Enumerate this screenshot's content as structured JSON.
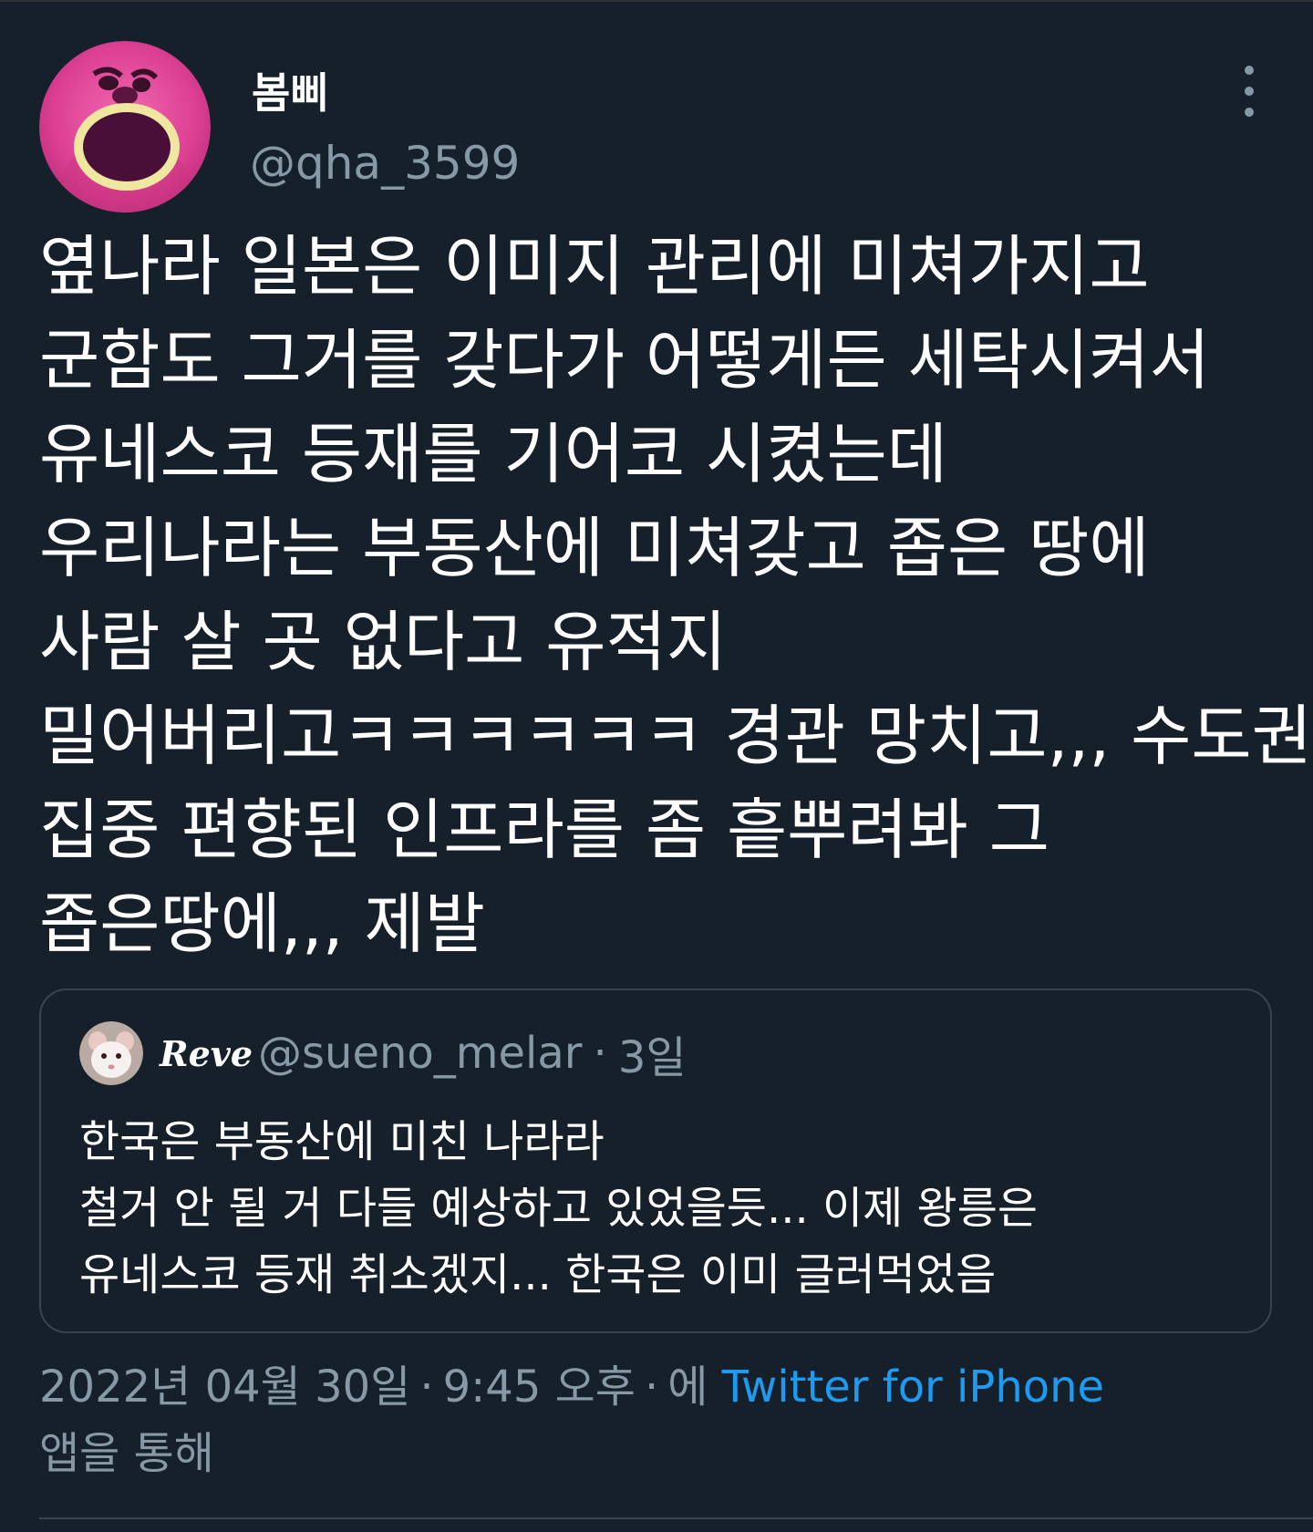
{
  "tweet": {
    "author": {
      "display_name": "봄삐",
      "handle": "@qha_3599",
      "avatar_icon": "pink-bear-face-avatar"
    },
    "more_icon": "more-vertical-icon",
    "text_lines": [
      "옆나라 일본은 이미지 관리에 미쳐가지고",
      "군함도 그거를 갖다가 어떻게든 세탁시켜서",
      "유네스코 등재를 기어코 시켰는데",
      "우리나라는 부동산에 미쳐갖고 좁은 땅에",
      "사람 살 곳 없다고 유적지",
      "밀어버리고ㅋㅋㅋㅋㅋㅋ 경관 망치고,,, 수도권",
      "집중 편향된 인프라를 좀 흩뿌려봐 그",
      "좁은땅에,,, 제발"
    ],
    "quote": {
      "name": "Reve",
      "handle": "@sueno_melar",
      "separator": "·",
      "time": "3일",
      "avatar_icon": "white-mouse-avatar",
      "text_lines": [
        "한국은 부동산에 미친 나라라",
        "철거 안 될 거 다들 예상하고 있었을듯... 이제 왕릉은",
        "유네스코 등재 취소겠지... 한국은 이미 글러먹었음"
      ]
    },
    "meta": {
      "date": "2022년 04월 30일",
      "separator": "·",
      "time": "9:45 오후",
      "via_prefix": "에",
      "source": "Twitter for iPhone",
      "suffix": "앱을 통해"
    }
  },
  "colors": {
    "background": "#15202b",
    "secondary_text": "#8899a6",
    "link": "#1d9bf0",
    "border": "#38444d"
  }
}
